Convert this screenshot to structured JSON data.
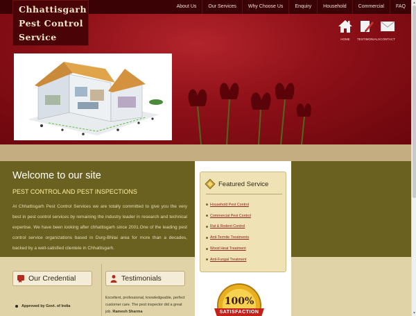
{
  "logo": {
    "line1": "Chhattisgarh",
    "line2": "Pest Control",
    "line3": "Service"
  },
  "nav": [
    "About Us",
    "Our Services",
    "Why Choose Us",
    "Enquiry",
    "Household",
    "Commercial",
    "FAQ"
  ],
  "quick_links": [
    {
      "label": "HOME",
      "icon": "home-icon"
    },
    {
      "label": "TESTIMONIALS",
      "icon": "edit-icon"
    },
    {
      "label": "CONTACT",
      "icon": "mail-icon"
    }
  ],
  "welcome": {
    "title": "Welcome to our site",
    "subtitle": "PEST CONTROL AND PEST INSPECTIONS",
    "paragraph": "At Chhattisgarh Pest Control Services we are totally committed to give you the very best in pest control services by remaining the industry leader in research and technical expertise. We have been looking after chhattisgarh since 2001.One of the leading pest control service organizations based in Durg-Bhilai area for more than a decades, backed by a well-satisfied clientele in Chhattisgarh."
  },
  "featured": {
    "title": "Featured Service",
    "items": [
      "Household Pest Control",
      "Commercial Pest Control",
      "Rat & Rodent Control",
      "Anti-Termite Treatments",
      "Wood Heat Treatment",
      "Anti-Fungal Treatment"
    ]
  },
  "credential": {
    "title": "Our Credential",
    "item": "Approved by Govt. of India"
  },
  "testimonials": {
    "title": "Testimonials",
    "text": "Excellent, professional, knowledgeable, perfect customer care. The pest inspector did a great job.",
    "author": "Ramesh Sharma"
  },
  "badge": {
    "percent": "100%",
    "word": "SATISFACTION"
  },
  "colors": {
    "header": "#8e1018",
    "olive": "#6a6020",
    "beige": "#c4ad80",
    "featured_bg": "#efe2b4"
  }
}
